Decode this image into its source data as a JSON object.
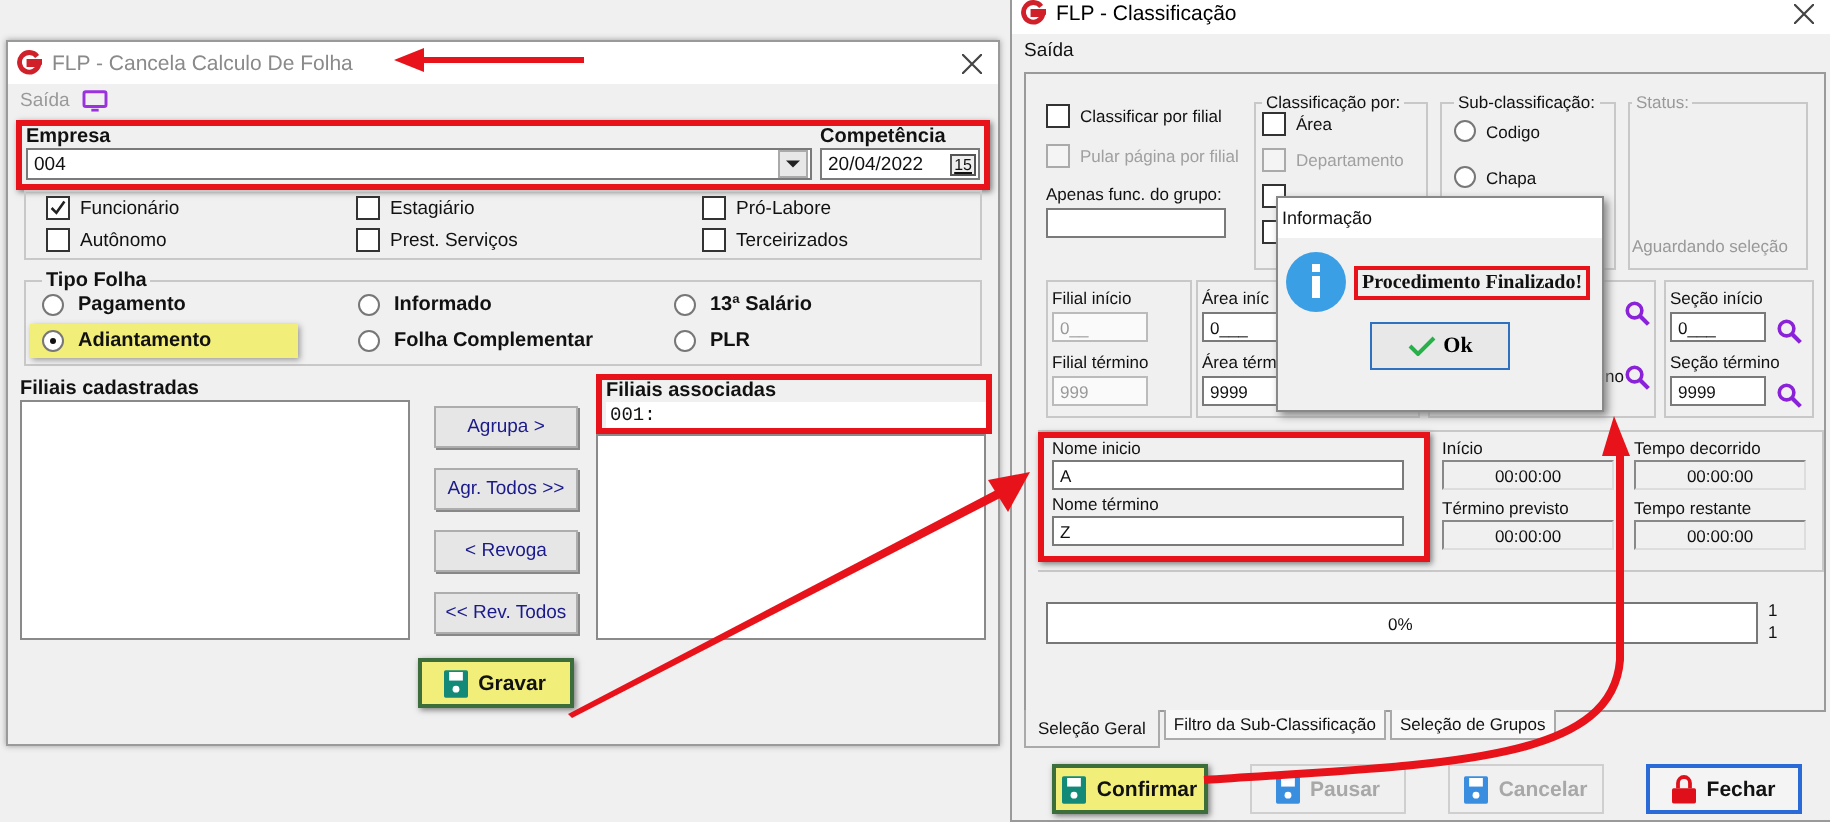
{
  "left_window": {
    "title": "FLP - Cancela Calculo De Folha",
    "active": false,
    "menu": [
      "Saída"
    ],
    "empresa": {
      "label": "Empresa",
      "value": "004",
      "outlined": true
    },
    "competencia": {
      "label": "Competência",
      "value": "20/04/2022",
      "calendar_label": "15"
    },
    "worker_types": [
      {
        "label": "Funcionário",
        "checked": true
      },
      {
        "label": "Estagiário",
        "checked": false
      },
      {
        "label": "Pró-Labore",
        "checked": false
      },
      {
        "label": "Autônomo",
        "checked": false
      },
      {
        "label": "Prest. Serviços",
        "checked": false
      },
      {
        "label": "Terceirizados",
        "checked": false
      }
    ],
    "tipo_folha": {
      "title": "Tipo Folha",
      "options": [
        {
          "label": "Pagamento",
          "selected": false,
          "highlighted": false
        },
        {
          "label": "Informado",
          "selected": false,
          "highlighted": false
        },
        {
          "label": "13ª Salário",
          "selected": false,
          "highlighted": false
        },
        {
          "label": "Adiantamento",
          "selected": true,
          "highlighted": true
        },
        {
          "label": "Folha Complementar",
          "selected": false,
          "highlighted": false
        },
        {
          "label": "PLR",
          "selected": false,
          "highlighted": false
        }
      ]
    },
    "filiais_cadastradas": {
      "label": "Filiais cadastradas"
    },
    "transfer_buttons": [
      "Agrupa >",
      "Agr. Todos >>",
      "< Revoga",
      "<< Rev. Todos"
    ],
    "filiais_associadas": {
      "label": "Filiais associadas",
      "items": [
        "001:"
      ],
      "outlined": true
    },
    "save_button": {
      "label": "Gravar",
      "highlighted": true
    }
  },
  "right_window": {
    "title": "FLP - Classificação",
    "active": true,
    "menu": [
      "Saída"
    ],
    "options": [
      {
        "label": "Classificar por filial",
        "checked": false,
        "disabled": false
      },
      {
        "label": "Pular página por filial",
        "checked": false,
        "disabled": true
      }
    ],
    "group_filter": {
      "label": "Apenas func. do grupo:"
    },
    "classificacao": {
      "title": "Classificação  por:",
      "items": [
        {
          "label": "Área",
          "checked": false,
          "disabled": false
        },
        {
          "label": "Departamento",
          "checked": false,
          "disabled": true
        },
        {
          "checked": false
        },
        {
          "checked": false
        }
      ]
    },
    "subclassificacao": {
      "title": "Sub-classificação:",
      "options": [
        {
          "label": "Codigo",
          "selected": false
        },
        {
          "label": "Chapa",
          "selected": false
        }
      ]
    },
    "status": {
      "title": "Status:",
      "text": "Aguardando seleção"
    },
    "ranges": [
      {
        "kind": "plain",
        "start_label": "Filial início",
        "start_value": "0__",
        "end_label": "Filial término",
        "end_value": "999",
        "disabled": true
      },
      {
        "kind": "plain",
        "start_label": "Área iníc",
        "start_value": "0___",
        "end_label": "Área térm",
        "end_value": "9999",
        "disabled": false
      },
      {
        "kind": "lookup",
        "end_label": "no"
      },
      {
        "kind": "lookup",
        "start_label": "Seção início",
        "start_value": "0___",
        "end_label": "Seção término",
        "end_value": "9999",
        "disabled": false
      }
    ],
    "name_range": {
      "start_label": "Nome inicio",
      "start_value": "A",
      "end_label": "Nome término",
      "end_value": "Z",
      "outlined": true
    },
    "times": [
      {
        "label": "Início",
        "value": "00:00:00"
      },
      {
        "label": "Tempo decorrido",
        "value": "00:00:00"
      },
      {
        "label": "Término previsto",
        "value": "00:00:00"
      },
      {
        "label": "Tempo restante",
        "value": "00:00:00"
      }
    ],
    "progress": {
      "level": 0,
      "text": "0%",
      "counters": [
        "1",
        "1"
      ]
    },
    "tabs": [
      {
        "label": "Seleção Geral",
        "selected": true
      },
      {
        "label": "Filtro da Sub-Classificação",
        "selected": false
      },
      {
        "label": "Seleção de Grupos",
        "selected": false
      }
    ],
    "buttons": [
      {
        "label": "Confirmar",
        "kind": "save",
        "disabled": false,
        "highlighted": true,
        "focused": false
      },
      {
        "label": "Pausar",
        "kind": "save",
        "disabled": true,
        "highlighted": false,
        "focused": false
      },
      {
        "label": "Cancelar",
        "kind": "save",
        "disabled": true,
        "highlighted": false,
        "focused": false
      },
      {
        "label": "Fechar",
        "kind": "lock",
        "disabled": false,
        "highlighted": false,
        "focused": true
      }
    ]
  },
  "dialog": {
    "title": "Informação",
    "message": "Procedimento Finalizado!",
    "outlined": true,
    "button": "Ok"
  }
}
